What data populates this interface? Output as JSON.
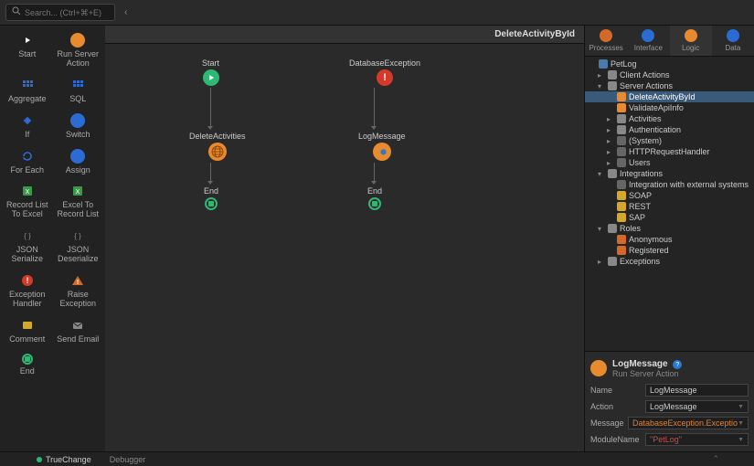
{
  "search": {
    "placeholder": "Search... (Ctrl+⌘+E)"
  },
  "palette": [
    {
      "label": "Start",
      "color": "#2eb872",
      "icon": "play"
    },
    {
      "label": "Run Server Action",
      "color": "#e88b2e",
      "icon": "circle"
    },
    {
      "label": "Aggregate",
      "color": "#2a6cd4",
      "icon": "grid"
    },
    {
      "label": "SQL",
      "color": "#2a6cd4",
      "icon": "grid"
    },
    {
      "label": "If",
      "color": "#2a6cd4",
      "icon": "diamond"
    },
    {
      "label": "Switch",
      "color": "#2a6cd4",
      "icon": "circle"
    },
    {
      "label": "For Each",
      "color": "#2a6cd4",
      "icon": "loop"
    },
    {
      "label": "Assign",
      "color": "#2a6cd4",
      "icon": "circle"
    },
    {
      "label": "Record List To Excel",
      "color": "#3a9a4a",
      "icon": "xl"
    },
    {
      "label": "Excel To Record List",
      "color": "#3a9a4a",
      "icon": "xl"
    },
    {
      "label": "JSON Serialize",
      "color": "#888",
      "icon": "json"
    },
    {
      "label": "JSON Deserialize",
      "color": "#888",
      "icon": "json"
    },
    {
      "label": "Exception Handler",
      "color": "#d43a2a",
      "icon": "exc"
    },
    {
      "label": "Raise Exception",
      "color": "#d46a2a",
      "icon": "warn"
    },
    {
      "label": "Comment",
      "color": "#d4a82a",
      "icon": "note"
    },
    {
      "label": "Send Email",
      "color": "#888",
      "icon": "mail"
    },
    {
      "label": "End",
      "color": "#2eb872",
      "icon": "stop"
    }
  ],
  "canvas": {
    "title": "DeleteActivityById",
    "leftFlow": {
      "start": "Start",
      "mid": "DeleteActivities",
      "end": "End"
    },
    "rightFlow": {
      "start": "DatabaseException",
      "mid": "LogMessage",
      "end": "End"
    }
  },
  "tabs": [
    {
      "label": "Processes",
      "color": "#d46a2a"
    },
    {
      "label": "Interface",
      "color": "#2a6cd4"
    },
    {
      "label": "Logic",
      "color": "#e88b2e",
      "active": true
    },
    {
      "label": "Data",
      "color": "#2a6cd4"
    }
  ],
  "tree": [
    {
      "d": 0,
      "t": "",
      "l": "PetLog",
      "c": "#4a7aaa",
      "icon": "app"
    },
    {
      "d": 1,
      "t": "▸",
      "l": "Client Actions",
      "c": "#888",
      "icon": "folder"
    },
    {
      "d": 1,
      "t": "▾",
      "l": "Server Actions",
      "c": "#888",
      "icon": "folder"
    },
    {
      "d": 2,
      "t": "",
      "l": "DeleteActivityById",
      "c": "#e88b2e",
      "icon": "act",
      "sel": true
    },
    {
      "d": 2,
      "t": "",
      "l": "ValidateApiInfo",
      "c": "#e88b2e",
      "icon": "act"
    },
    {
      "d": 2,
      "t": "▸",
      "l": "Activities",
      "c": "#888",
      "icon": "folder"
    },
    {
      "d": 2,
      "t": "▸",
      "l": "Authentication",
      "c": "#888",
      "icon": "folder"
    },
    {
      "d": 2,
      "t": "▸",
      "l": "(System)",
      "c": "#666",
      "icon": "sys"
    },
    {
      "d": 2,
      "t": "▸",
      "l": "HTTPRequestHandler",
      "c": "#666",
      "icon": "sys"
    },
    {
      "d": 2,
      "t": "▸",
      "l": "Users",
      "c": "#666",
      "icon": "sys"
    },
    {
      "d": 1,
      "t": "▾",
      "l": "Integrations",
      "c": "#888",
      "icon": "folder"
    },
    {
      "d": 2,
      "t": "",
      "l": "Integration with external systems",
      "c": "#666",
      "icon": "info"
    },
    {
      "d": 2,
      "t": "",
      "l": "SOAP",
      "c": "#d4a82a",
      "icon": "soap"
    },
    {
      "d": 2,
      "t": "",
      "l": "REST",
      "c": "#d4a82a",
      "icon": "rest"
    },
    {
      "d": 2,
      "t": "",
      "l": "SAP",
      "c": "#d4a82a",
      "icon": "sap"
    },
    {
      "d": 1,
      "t": "▾",
      "l": "Roles",
      "c": "#888",
      "icon": "folder"
    },
    {
      "d": 2,
      "t": "",
      "l": "Anonymous",
      "c": "#d46a2a",
      "icon": "role"
    },
    {
      "d": 2,
      "t": "",
      "l": "Registered",
      "c": "#d46a2a",
      "icon": "role"
    },
    {
      "d": 1,
      "t": "▸",
      "l": "Exceptions",
      "c": "#888",
      "icon": "folder"
    }
  ],
  "props": {
    "title": "LogMessage",
    "subtitle": "Run Server Action",
    "rows": [
      {
        "label": "Name",
        "value": "LogMessage",
        "kind": "text"
      },
      {
        "label": "Action",
        "value": "LogMessage",
        "kind": "select"
      },
      {
        "label": "Message",
        "value": "DatabaseException.Exceptio",
        "kind": "expr"
      },
      {
        "label": "ModuleName",
        "value": "\"PetLog\"",
        "kind": "str"
      }
    ]
  },
  "bottomTabs": {
    "trueChange": "TrueChange",
    "debugger": "Debugger"
  }
}
